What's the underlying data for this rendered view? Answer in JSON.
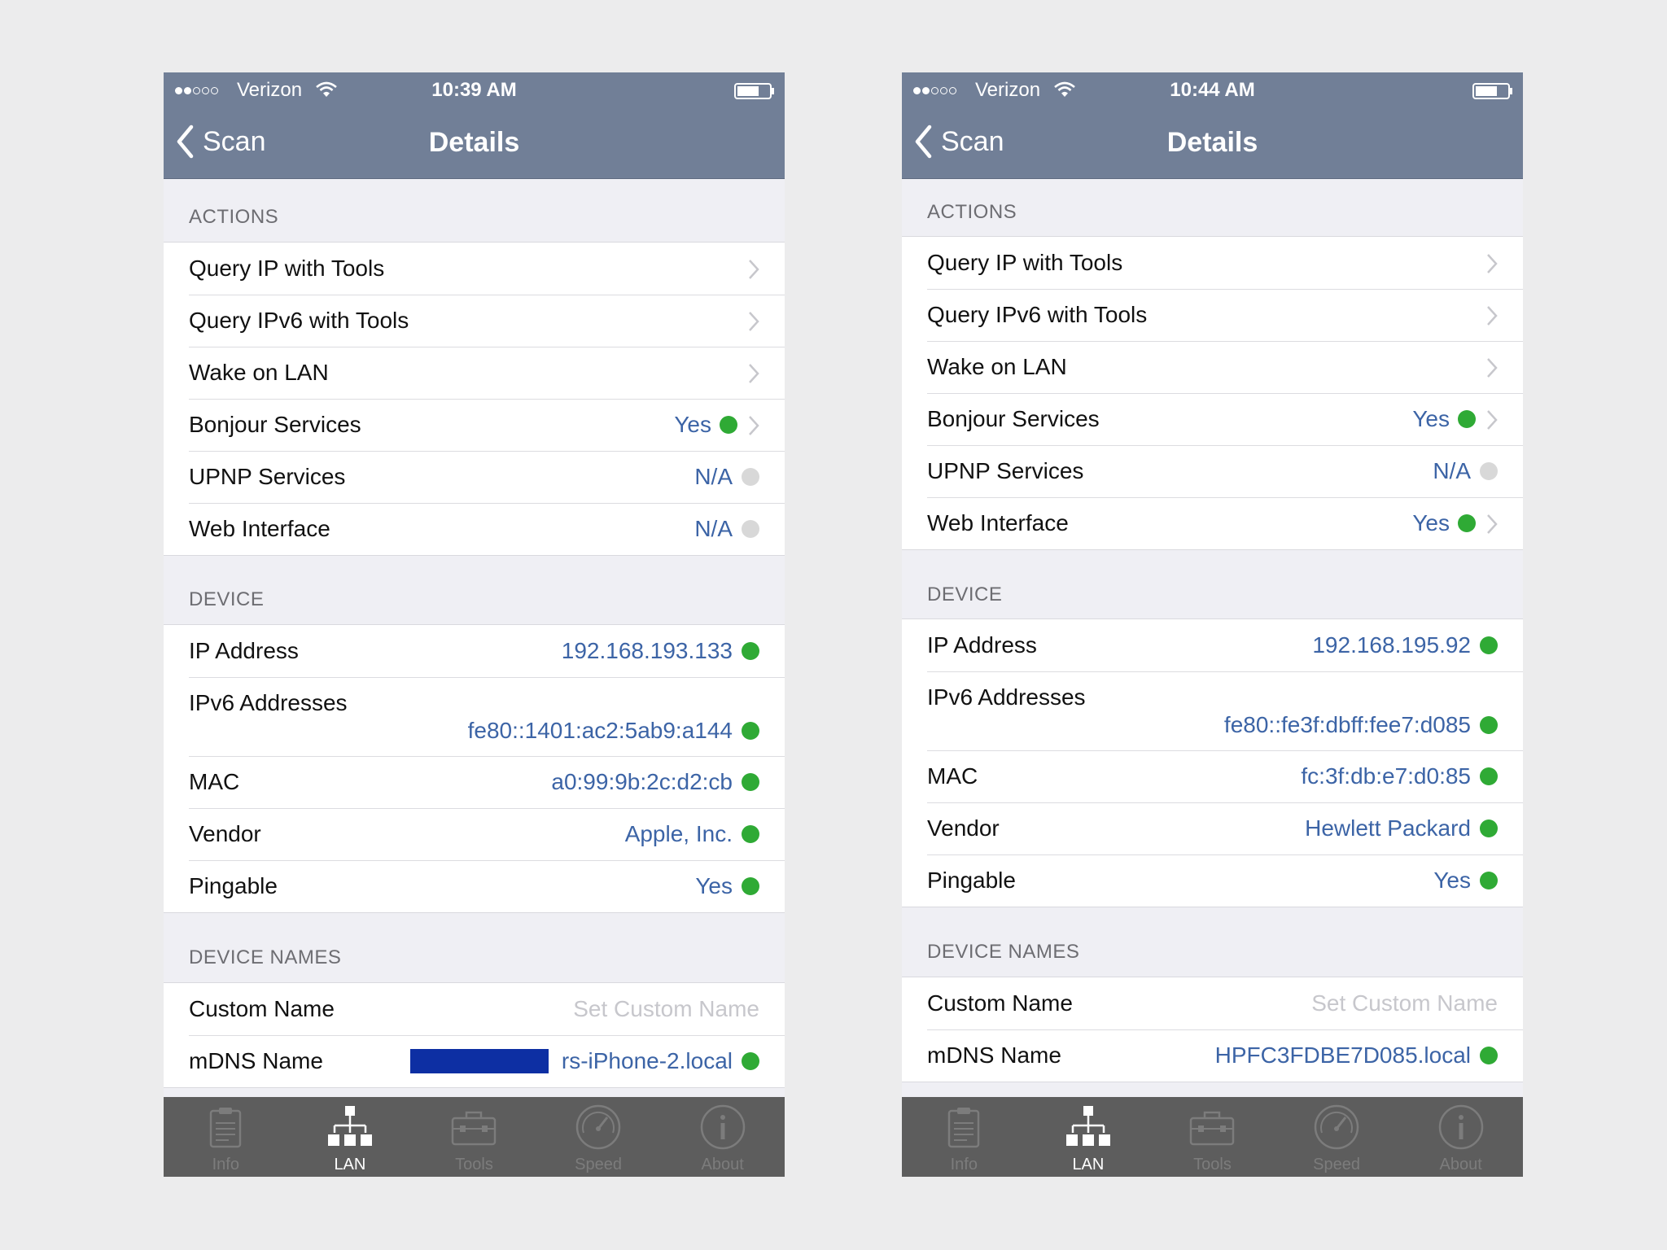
{
  "screens": [
    {
      "status": {
        "carrier": "Verizon",
        "time": "10:39 AM"
      },
      "nav": {
        "back_label": "Scan",
        "title": "Details"
      },
      "actions": {
        "header": "ACTIONS",
        "rows": [
          {
            "label": "Query IP with Tools"
          },
          {
            "label": "Query IPv6 with Tools"
          },
          {
            "label": "Wake on LAN"
          },
          {
            "label": "Bonjour Services",
            "value": "Yes"
          },
          {
            "label": "UPNP Services",
            "value": "N/A"
          },
          {
            "label": "Web Interface",
            "value": "N/A"
          }
        ]
      },
      "device": {
        "header": "DEVICE",
        "rows": [
          {
            "label": "IP Address",
            "value": "192.168.193.133"
          },
          {
            "label": "IPv6 Addresses",
            "value": "fe80::1401:ac2:5ab9:a144"
          },
          {
            "label": "MAC",
            "value": "a0:99:9b:2c:d2:cb"
          },
          {
            "label": "Vendor",
            "value": "Apple, Inc."
          },
          {
            "label": "Pingable",
            "value": "Yes"
          }
        ]
      },
      "names": {
        "header": "DEVICE NAMES",
        "rows": [
          {
            "label": "Custom Name",
            "value": "Set Custom Name"
          },
          {
            "label": "mDNS Name",
            "value": "rs-iPhone-2.local"
          }
        ]
      }
    },
    {
      "status": {
        "carrier": "Verizon",
        "time": "10:44 AM"
      },
      "nav": {
        "back_label": "Scan",
        "title": "Details"
      },
      "actions": {
        "header": "ACTIONS",
        "rows": [
          {
            "label": "Query IP with Tools"
          },
          {
            "label": "Query IPv6 with Tools"
          },
          {
            "label": "Wake on LAN"
          },
          {
            "label": "Bonjour Services",
            "value": "Yes"
          },
          {
            "label": "UPNP Services",
            "value": "N/A"
          },
          {
            "label": "Web Interface",
            "value": "Yes"
          }
        ]
      },
      "device": {
        "header": "DEVICE",
        "rows": [
          {
            "label": "IP Address",
            "value": "192.168.195.92"
          },
          {
            "label": "IPv6 Addresses",
            "value": "fe80::fe3f:dbff:fee7:d085"
          },
          {
            "label": "MAC",
            "value": "fc:3f:db:e7:d0:85"
          },
          {
            "label": "Vendor",
            "value": "Hewlett Packard"
          },
          {
            "label": "Pingable",
            "value": "Yes"
          }
        ]
      },
      "names": {
        "header": "DEVICE NAMES",
        "rows": [
          {
            "label": "Custom Name",
            "value": "Set Custom Name"
          },
          {
            "label": "mDNS Name",
            "value": "HPFC3FDBE7D085.local"
          }
        ]
      }
    }
  ],
  "tab_bar": {
    "tabs": [
      {
        "label": "Info",
        "icon": "clipboard-icon"
      },
      {
        "label": "LAN",
        "icon": "network-icon"
      },
      {
        "label": "Tools",
        "icon": "toolbox-icon"
      },
      {
        "label": "Speed",
        "icon": "speedometer-icon"
      },
      {
        "label": "About",
        "icon": "info-circle-icon"
      }
    ],
    "active": "LAN"
  },
  "colors": {
    "nav_bar": "#717f97",
    "value_text": "#3c64a6",
    "status_green": "#2faa35",
    "status_grey": "#d8d8d8",
    "tab_bar": "#5d5d5d",
    "redaction": "#0d2fa3"
  }
}
